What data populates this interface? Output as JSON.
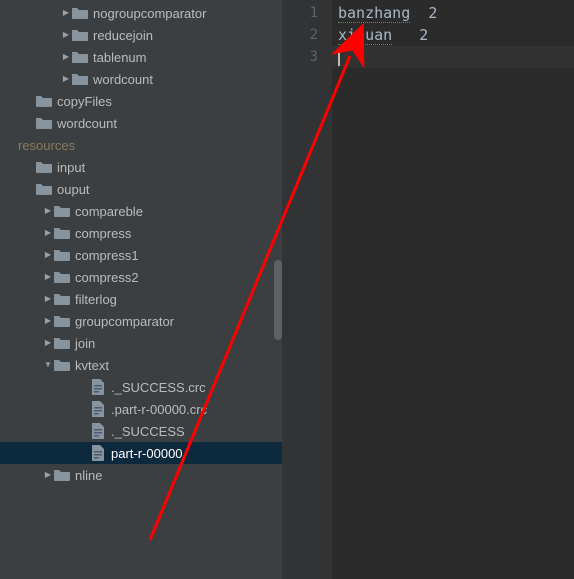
{
  "tree": {
    "items": [
      {
        "kind": "folder",
        "arrow": "right",
        "level": 2,
        "label": "nogroupcomparator"
      },
      {
        "kind": "folder",
        "arrow": "right",
        "level": 2,
        "label": "reducejoin"
      },
      {
        "kind": "folder",
        "arrow": "right",
        "level": 2,
        "label": "tablenum"
      },
      {
        "kind": "folder",
        "arrow": "right",
        "level": 2,
        "label": "wordcount"
      },
      {
        "kind": "folder",
        "arrow": "none",
        "level": 0,
        "label": "copyFiles"
      },
      {
        "kind": "folder",
        "arrow": "none",
        "level": 0,
        "label": "wordcount"
      },
      {
        "kind": "resources",
        "arrow": "none",
        "level": -1,
        "label": "resources"
      },
      {
        "kind": "folder",
        "arrow": "none",
        "level": 0,
        "label": "input"
      },
      {
        "kind": "folder",
        "arrow": "none",
        "level": 0,
        "label": "ouput"
      },
      {
        "kind": "folder",
        "arrow": "right",
        "level": 1,
        "label": "compareble"
      },
      {
        "kind": "folder",
        "arrow": "right",
        "level": 1,
        "label": "compress"
      },
      {
        "kind": "folder",
        "arrow": "right",
        "level": 1,
        "label": "compress1"
      },
      {
        "kind": "folder",
        "arrow": "right",
        "level": 1,
        "label": "compress2"
      },
      {
        "kind": "folder",
        "arrow": "right",
        "level": 1,
        "label": "filterlog"
      },
      {
        "kind": "folder",
        "arrow": "right",
        "level": 1,
        "label": "groupcomparator"
      },
      {
        "kind": "folder",
        "arrow": "right",
        "level": 1,
        "label": "join"
      },
      {
        "kind": "folder",
        "arrow": "down",
        "level": 1,
        "label": "kvtext"
      },
      {
        "kind": "file",
        "arrow": "none",
        "level": 3,
        "label": "._SUCCESS.crc"
      },
      {
        "kind": "file",
        "arrow": "none",
        "level": 3,
        "label": ".part-r-00000.crc"
      },
      {
        "kind": "file",
        "arrow": "none",
        "level": 3,
        "label": "._SUCCESS"
      },
      {
        "kind": "file",
        "arrow": "none",
        "level": 3,
        "label": "part-r-00000",
        "selected": true
      },
      {
        "kind": "folder",
        "arrow": "right",
        "level": 1,
        "label": "nline"
      }
    ]
  },
  "editor": {
    "gutter": [
      "1",
      "2",
      "3"
    ],
    "lines": [
      {
        "word": "banzhang",
        "count": "2"
      },
      {
        "word": "xihuan",
        "count": "2"
      }
    ]
  }
}
